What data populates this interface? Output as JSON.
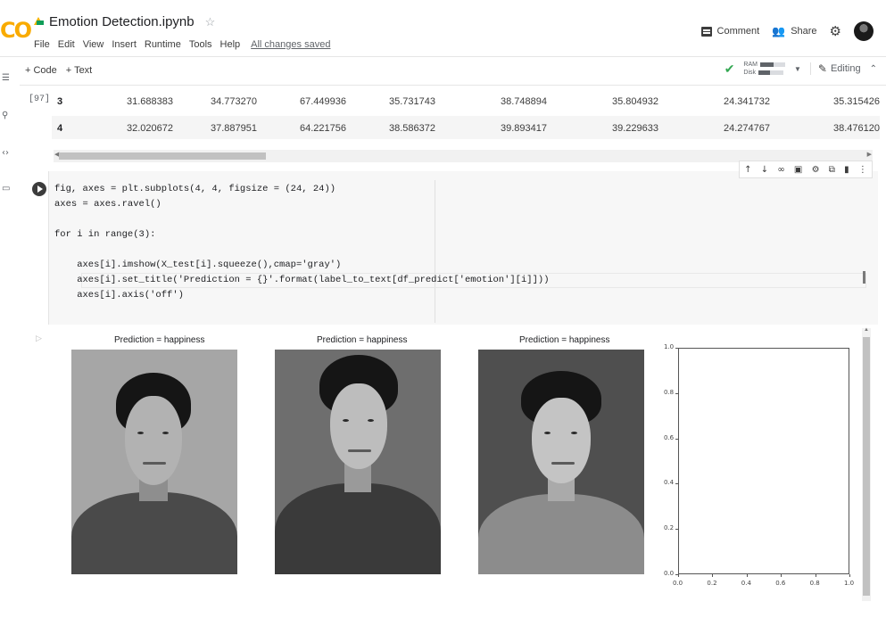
{
  "header": {
    "logo": "CO",
    "title": "Emotion Detection.ipynb",
    "menu": [
      "File",
      "Edit",
      "View",
      "Insert",
      "Runtime",
      "Tools",
      "Help"
    ],
    "save_status": "All changes saved",
    "comment_label": "Comment",
    "share_label": "Share"
  },
  "toolbar": {
    "add_code": "+ Code",
    "add_text": "+ Text",
    "ram_label": "RAM",
    "disk_label": "Disk",
    "ram_level": 0.55,
    "disk_level": 0.45,
    "editing_label": "Editing"
  },
  "table_output": {
    "exec_count": "[97]",
    "rows": [
      {
        "index": "3",
        "cells": [
          "31.688383",
          "34.773270",
          "67.449936",
          "35.731743",
          "38.748894",
          "35.804932",
          "24.341732",
          "35.315426"
        ]
      },
      {
        "index": "4",
        "cells": [
          "32.020672",
          "37.887951",
          "64.221756",
          "38.586372",
          "39.893417",
          "39.229633",
          "24.274767",
          "38.476120"
        ]
      }
    ]
  },
  "code_cell": {
    "lines": [
      "fig, axes = plt.subplots(4, 4, figsize = (24, 24))",
      "axes = axes.ravel()",
      "",
      "for i in range(3):",
      "",
      "    axes[i].imshow(X_test[i].squeeze(),cmap='gray')",
      "    axes[i].set_title('Prediction = {}'.format(label_to_text[df_predict['emotion'][i]]))",
      "    axes[i].axis('off')"
    ]
  },
  "figure_output": {
    "titles": [
      "Prediction = happiness",
      "Prediction = happiness",
      "Prediction = happiness"
    ],
    "empty_axes": {
      "y_ticks": [
        "1.0",
        "0.8",
        "0.6",
        "0.4",
        "0.2",
        "0.0"
      ],
      "x_ticks": [
        "0.0",
        "0.2",
        "0.4",
        "0.6",
        "0.8",
        "1.0"
      ]
    }
  },
  "colors": {
    "logo": "#f9ab00",
    "status_ok": "#34a853",
    "keyword": "#7b1fa2",
    "number": "#1565c0",
    "string": "#c62828"
  }
}
